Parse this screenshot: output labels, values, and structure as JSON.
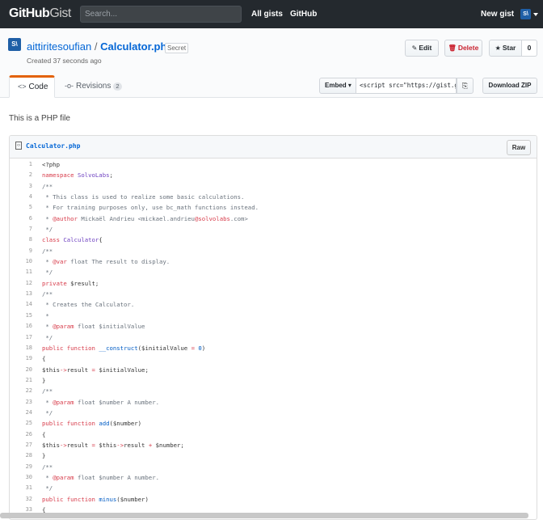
{
  "header": {
    "logo_bold": "GitHub",
    "logo_light": "Gist",
    "search_placeholder": "Search...",
    "nav": [
      "All gists",
      "GitHub"
    ],
    "new_gist": "New gist"
  },
  "gist": {
    "owner": "aittiritesoufian",
    "separator": "/",
    "filename": "Calculator.php",
    "visibility": "Secret",
    "created": "Created 37 seconds ago",
    "description": "This is a PHP file"
  },
  "actions": {
    "edit": "Edit",
    "delete": "Delete",
    "star": "Star",
    "star_count": "0",
    "embed": "Embed",
    "embed_value": "<script src=\"https://gist.github.com/",
    "download": "Download ZIP",
    "raw": "Raw"
  },
  "tabs": [
    {
      "label": "Code",
      "active": true
    },
    {
      "label": "Revisions",
      "count": "2"
    }
  ],
  "code": [
    "<?php",
    "namespace SolvoLabs;",
    "/**",
    " * This class is used to realize some basic calculations.",
    " * For training purposes only, use bc_math functions instead.",
    " * @author Mickaël Andrieu <mickael.andrieu@solvolabs.com>",
    " */",
    "class Calculator{",
    "/**",
    " * @var float The result to display.",
    " */",
    "private $result;",
    "/**",
    " * Creates the Calculator.",
    " *",
    " * @param float $initialValue",
    " */",
    "public function __construct($initialValue = 0)",
    "{",
    "$this->result = $initialValue;",
    "}",
    "/**",
    " * @param float $number A number.",
    " */",
    "public function add($number)",
    "{",
    "$this->result = $this->result + $number;",
    "}",
    "/**",
    " * @param float $number A number.",
    " */",
    "public function minus($number)",
    "{"
  ],
  "colors": {
    "header_bg": "#24292e",
    "link": "#0366d6",
    "active_tab_accent": "#e36209",
    "delete": "#cb2431"
  }
}
